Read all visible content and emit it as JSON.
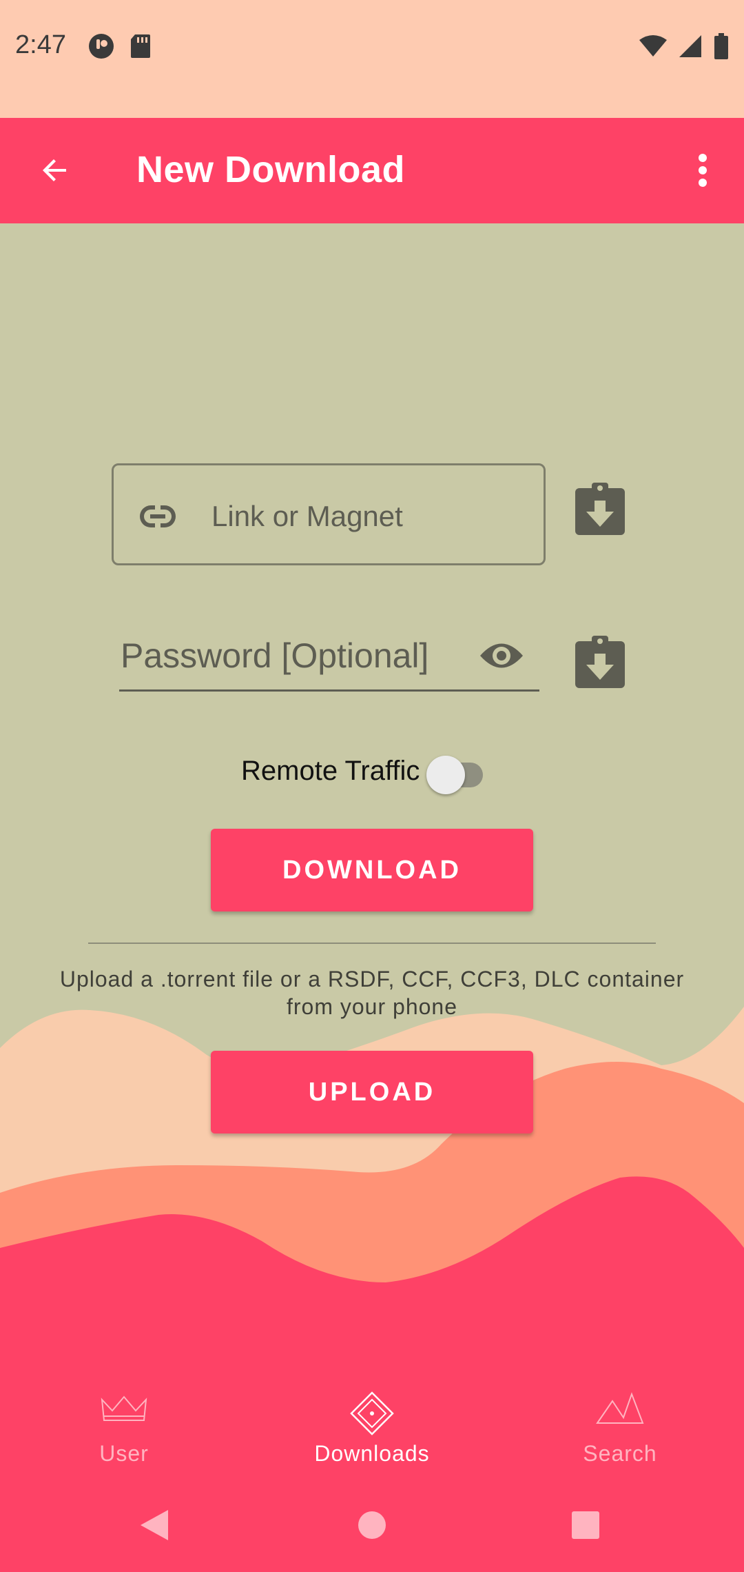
{
  "status_bar": {
    "time": "2:47"
  },
  "app_bar": {
    "title": "New Download"
  },
  "form": {
    "link_placeholder": "Link or Magnet",
    "password_placeholder": "Password [Optional]",
    "remote_traffic_label": "Remote Traffic",
    "remote_traffic_enabled": false,
    "download_label": "DOWNLOAD",
    "upload_info": "Upload a .torrent file or a RSDF, CCF, CCF3, DLC container from your phone",
    "upload_label": "UPLOAD"
  },
  "bottom_nav": {
    "items": [
      {
        "label": "User",
        "icon": "crown-icon",
        "active": false
      },
      {
        "label": "Downloads",
        "icon": "diamond-icon",
        "active": true
      },
      {
        "label": "Search",
        "icon": "mountains-icon",
        "active": false
      }
    ]
  },
  "colors": {
    "accent": "#fe4266",
    "background": "#c9c9a6",
    "status_bar": "#fecbb1",
    "wave_light": "#f9ccac",
    "wave_mid": "#ff9276"
  }
}
